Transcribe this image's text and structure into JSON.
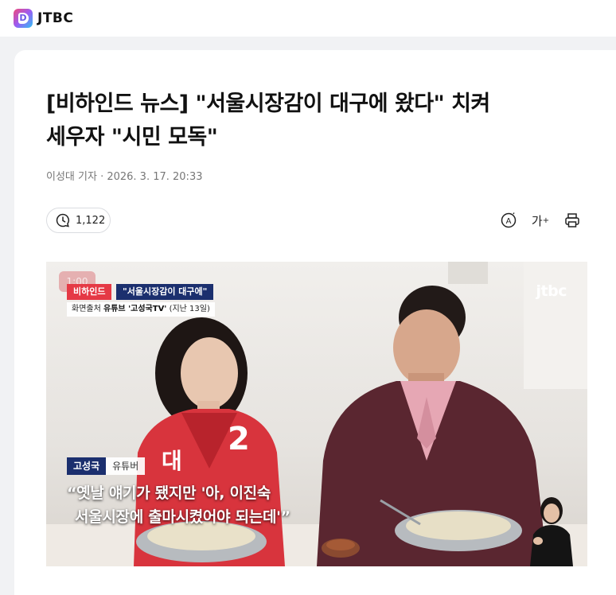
{
  "header": {
    "logo_letter": "D",
    "brand": "JTBC"
  },
  "article": {
    "title_line1": "[비하인드 뉴스] \"서울시장감이 대구에 왔다\" 치켜",
    "title_line2": "세우자 \"시민 모독\"",
    "byline": "이성대 기자 · 2026. 3. 17. 20:33",
    "comment_count": "1,122"
  },
  "toolbar": {
    "icons": [
      "summary-icon",
      "font-size-icon",
      "print-icon"
    ],
    "font_size_glyph": "가",
    "summary_glyph": "A"
  },
  "video": {
    "timer": "1:00",
    "tag_section": "비하인드",
    "tag_title": "\"서울시장감이 대구에\"",
    "source_prefix": "화면출처",
    "source_channel": "유튜브 '고성국TV'",
    "source_date": "(지난 13일)",
    "watermark": "jtbc",
    "speaker_name": "고성국",
    "speaker_role": "유튜버",
    "quote_line1": "“옛날 얘기가 됐지만 '아, 이진숙",
    "quote_line2": "서울시장에 출마시켰어야 되는데'”",
    "sign_number": "2",
    "sign_text": "대"
  },
  "colors": {
    "accent_red": "#e53945",
    "accent_navy": "#1b2f6e",
    "jacket_red": "#d8343d",
    "jacket_brown": "#5a2630"
  }
}
